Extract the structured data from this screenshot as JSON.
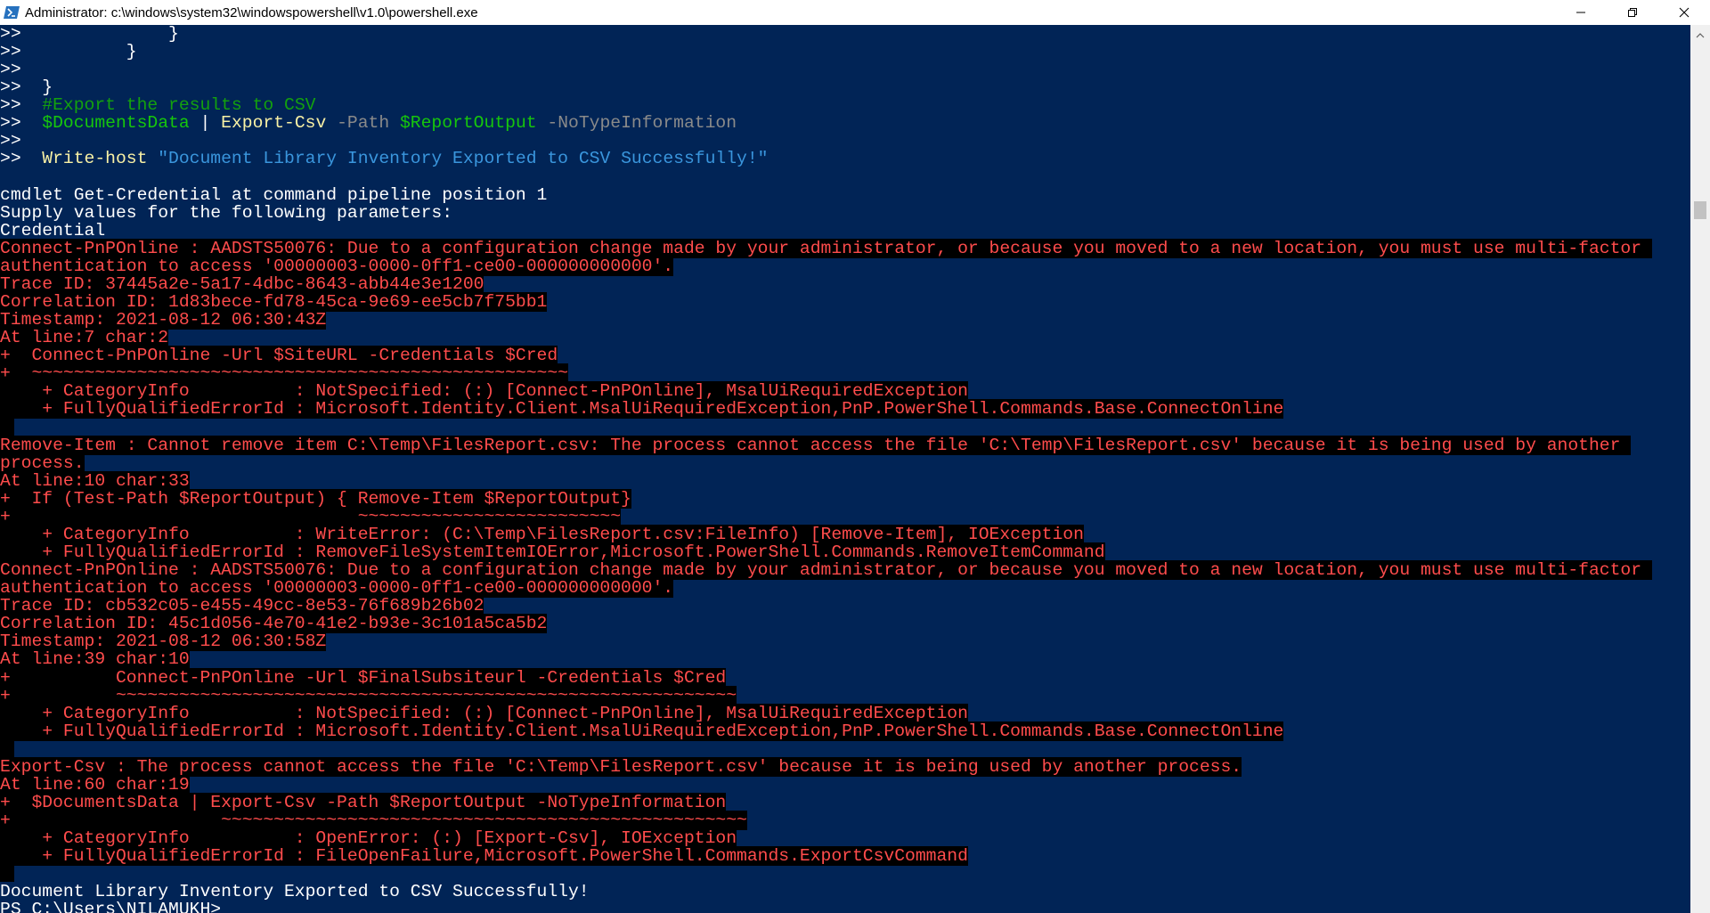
{
  "window": {
    "title": "Administrator: c:\\windows\\system32\\windowspowershell\\v1.0\\powershell.exe",
    "icons": {
      "app": "powershell-icon",
      "minimize": "minimize-icon",
      "maximize": "restore-icon",
      "close": "close-icon"
    }
  },
  "colors": {
    "console_background": "#012456",
    "error_foreground": "#ff4c4c",
    "error_background": "#000000",
    "comment": "#13a10e",
    "variable": "#16c60c",
    "command": "#f9f1a5",
    "parameter": "#8a8a8a",
    "string": "#3a96dd"
  },
  "console": {
    "script_lines": [
      {
        "prompt": ">>",
        "tokens": [
          {
            "t": "              }",
            "k": "plain"
          }
        ]
      },
      {
        "prompt": ">>",
        "tokens": [
          {
            "t": "          }",
            "k": "plain"
          }
        ]
      },
      {
        "prompt": ">>",
        "tokens": []
      },
      {
        "prompt": ">>",
        "tokens": [
          {
            "t": "  }",
            "k": "plain"
          }
        ]
      },
      {
        "prompt": ">>",
        "tokens": [
          {
            "t": "  #Export the results to CSV",
            "k": "comment"
          }
        ]
      },
      {
        "prompt": ">>",
        "tokens": [
          {
            "t": "  $DocumentsData",
            "k": "var"
          },
          {
            "t": " | ",
            "k": "plain"
          },
          {
            "t": "Export-Csv",
            "k": "cmd"
          },
          {
            "t": " -Path ",
            "k": "param"
          },
          {
            "t": "$ReportOutput",
            "k": "var"
          },
          {
            "t": " -NoTypeInformation",
            "k": "param"
          }
        ]
      },
      {
        "prompt": ">>",
        "tokens": []
      },
      {
        "prompt": ">>",
        "tokens": [
          {
            "t": "  Write-host",
            "k": "cmd"
          },
          {
            "t": " \"Document Library Inventory Exported to CSV Successfully!\"",
            "k": "string"
          }
        ]
      }
    ],
    "output_lines": [
      {
        "text": "",
        "style": "blue"
      },
      {
        "text": "cmdlet Get-Credential at command pipeline position 1",
        "style": "blue"
      },
      {
        "text": "Supply values for the following parameters:",
        "style": "blue"
      },
      {
        "text": "Credential",
        "style": "blue"
      },
      {
        "text": "Connect-PnPOnline : AADSTS50076: Due to a configuration change made by your administrator, or because you moved to a new location, you must use multi-factor ",
        "style": "error"
      },
      {
        "text": "authentication to access '00000003-0000-0ff1-ce00-000000000000'.",
        "style": "error"
      },
      {
        "text": "Trace ID: 37445a2e-5a17-4dbc-8643-abb44e3e1200",
        "style": "error"
      },
      {
        "text": "Correlation ID: 1d83bece-fd78-45ca-9e69-ee5cb7f75bb1",
        "style": "error"
      },
      {
        "text": "Timestamp: 2021-08-12 06:30:43Z",
        "style": "error"
      },
      {
        "text": "At line:7 char:2",
        "style": "error"
      },
      {
        "text": "+  Connect-PnPOnline -Url $SiteURL -Credentials $Cred",
        "style": "error"
      },
      {
        "text": "+  ~~~~~~~~~~~~~~~~~~~~~~~~~~~~~~~~~~~~~~~~~~~~~~~~~~~",
        "style": "error"
      },
      {
        "text": "    + CategoryInfo          : NotSpecified: (:) [Connect-PnPOnline], MsalUiRequiredException",
        "style": "error"
      },
      {
        "text": "    + FullyQualifiedErrorId : Microsoft.Identity.Client.MsalUiRequiredException,PnP.PowerShell.Commands.Base.ConnectOnline",
        "style": "error"
      },
      {
        "text": "",
        "style": "blank-error"
      },
      {
        "text": "Remove-Item : Cannot remove item C:\\Temp\\FilesReport.csv: The process cannot access the file 'C:\\Temp\\FilesReport.csv' because it is being used by another ",
        "style": "error"
      },
      {
        "text": "process.",
        "style": "error"
      },
      {
        "text": "At line:10 char:33",
        "style": "error"
      },
      {
        "text": "+  If (Test-Path $ReportOutput) { Remove-Item $ReportOutput}",
        "style": "error"
      },
      {
        "text": "+                                 ~~~~~~~~~~~~~~~~~~~~~~~~~",
        "style": "error"
      },
      {
        "text": "    + CategoryInfo          : WriteError: (C:\\Temp\\FilesReport.csv:FileInfo) [Remove-Item], IOException",
        "style": "error"
      },
      {
        "text": "    + FullyQualifiedErrorId : RemoveFileSystemItemIOError,Microsoft.PowerShell.Commands.RemoveItemCommand",
        "style": "error"
      },
      {
        "text": "Connect-PnPOnline : AADSTS50076: Due to a configuration change made by your administrator, or because you moved to a new location, you must use multi-factor ",
        "style": "error"
      },
      {
        "text": "authentication to access '00000003-0000-0ff1-ce00-000000000000'.",
        "style": "error"
      },
      {
        "text": "Trace ID: cb532c05-e455-49cc-8e53-76f689b26b02",
        "style": "error"
      },
      {
        "text": "Correlation ID: 45c1d056-4e70-41e2-b93e-3c101a5ca5b2",
        "style": "error"
      },
      {
        "text": "Timestamp: 2021-08-12 06:30:58Z",
        "style": "error"
      },
      {
        "text": "At line:39 char:10",
        "style": "error"
      },
      {
        "text": "+          Connect-PnPOnline -Url $FinalSubsiteurl -Credentials $Cred",
        "style": "error"
      },
      {
        "text": "+          ~~~~~~~~~~~~~~~~~~~~~~~~~~~~~~~~~~~~~~~~~~~~~~~~~~~~~~~~~~~",
        "style": "error"
      },
      {
        "text": "    + CategoryInfo          : NotSpecified: (:) [Connect-PnPOnline], MsalUiRequiredException",
        "style": "error"
      },
      {
        "text": "    + FullyQualifiedErrorId : Microsoft.Identity.Client.MsalUiRequiredException,PnP.PowerShell.Commands.Base.ConnectOnline",
        "style": "error"
      },
      {
        "text": "",
        "style": "blank-error"
      },
      {
        "text": "Export-Csv : The process cannot access the file 'C:\\Temp\\FilesReport.csv' because it is being used by another process.",
        "style": "error"
      },
      {
        "text": "At line:60 char:19",
        "style": "error"
      },
      {
        "text": "+  $DocumentsData | Export-Csv -Path $ReportOutput -NoTypeInformation",
        "style": "error"
      },
      {
        "text": "+                    ~~~~~~~~~~~~~~~~~~~~~~~~~~~~~~~~~~~~~~~~~~~~~~~~~~",
        "style": "error"
      },
      {
        "text": "    + CategoryInfo          : OpenError: (:) [Export-Csv], IOException",
        "style": "error"
      },
      {
        "text": "    + FullyQualifiedErrorId : FileOpenFailure,Microsoft.PowerShell.Commands.ExportCsvCommand",
        "style": "error"
      },
      {
        "text": "",
        "style": "blank-error"
      },
      {
        "text": "Document Library Inventory Exported to CSV Successfully!",
        "style": "blue"
      },
      {
        "text": "PS C:\\Users\\NILAMUKH>",
        "style": "blue"
      }
    ]
  }
}
